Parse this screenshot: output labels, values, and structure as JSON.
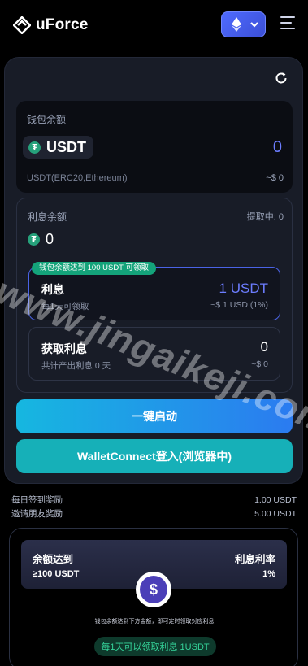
{
  "header": {
    "brand": "uForce",
    "chain": {
      "icon": "ethereum-icon",
      "accent": "#4f6bff"
    }
  },
  "wallet": {
    "title": "钱包余额",
    "token": "USDT",
    "amount": "0",
    "network": "USDT(ERC20,Ethereum)",
    "usd_value": "~$ 0"
  },
  "interest": {
    "title": "利息余额",
    "withdrawing": "提取中: 0",
    "balance": "0",
    "badge": "钱包余额达到 100 USDT 可领取",
    "rate_card": {
      "title": "利息",
      "subtitle": "每1天可领取",
      "amount": "1 USDT",
      "usd": "~$ 1 USD (1%)"
    },
    "get_card": {
      "title": "获取利息",
      "subtitle": "共计产出利息 0 天",
      "amount": "0",
      "usd": "~$ 0"
    }
  },
  "buttons": {
    "start": "一键启动",
    "walletconnect": "WalletConnect登入(浏览器中)"
  },
  "rewards": [
    {
      "label": "每日签到奖励",
      "value": "1.00 USDT"
    },
    {
      "label": "邀请朋友奖励",
      "value": "5.00 USDT"
    }
  ],
  "tier": {
    "left_label": "余额达到",
    "left_value": "≥100 USDT",
    "right_label": "利息利率",
    "right_value": "1%",
    "note": "钱包余额达到下方金额，即可定时领取对应利息",
    "claim": "每1天可以领取利息 1USDT"
  },
  "watermark": "www.jingaikeji.com",
  "colors": {
    "accent_blue": "#6c7dff",
    "teal_button": "#16b0b8",
    "tether_green": "#26a17b"
  }
}
